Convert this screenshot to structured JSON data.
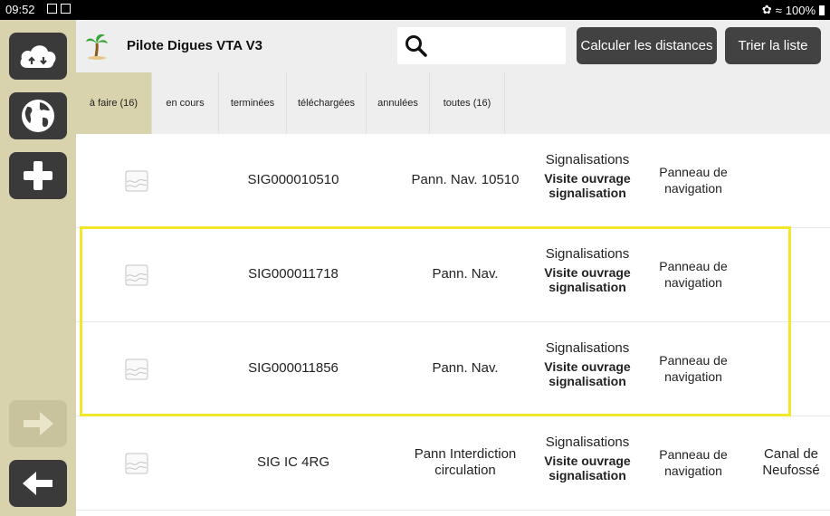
{
  "status_bar": {
    "time": "09:52",
    "battery": "100%"
  },
  "header": {
    "app_title": "Pilote Digues VTA V3",
    "search_value": "",
    "btn_distances": "Calculer les distances",
    "btn_sort": "Trier la liste"
  },
  "tabs": [
    {
      "label": "à faire (16)",
      "active": true
    },
    {
      "label": "en cours"
    },
    {
      "label": "terminées"
    },
    {
      "label": "téléchargées"
    },
    {
      "label": "annulées"
    },
    {
      "label": "toutes (16)"
    }
  ],
  "rows": [
    {
      "code": "SIG000010510",
      "name": "Pann. Nav. 10510",
      "category": "Signalisations",
      "action": "Visite ouvrage signalisation",
      "type": "Panneau de navigation",
      "canal": ""
    },
    {
      "code": "SIG000011718",
      "name": "Pann. Nav.",
      "category": "Signalisations",
      "action": "Visite ouvrage signalisation",
      "type": "Panneau de navigation",
      "canal": ""
    },
    {
      "code": "SIG000011856",
      "name": "Pann. Nav.",
      "category": "Signalisations",
      "action": "Visite ouvrage signalisation",
      "type": "Panneau de navigation",
      "canal": ""
    },
    {
      "code": "SIG IC 4RG",
      "name": "Pann Interdiction circulation",
      "category": "Signalisations",
      "action": "Visite ouvrage signalisation",
      "type": "Panneau de navigation",
      "canal": "Canal de Neufossé"
    }
  ],
  "colors": {
    "sidebar": "#d8d3ad",
    "button_dark": "#424242",
    "highlight": "#f3e62b"
  }
}
